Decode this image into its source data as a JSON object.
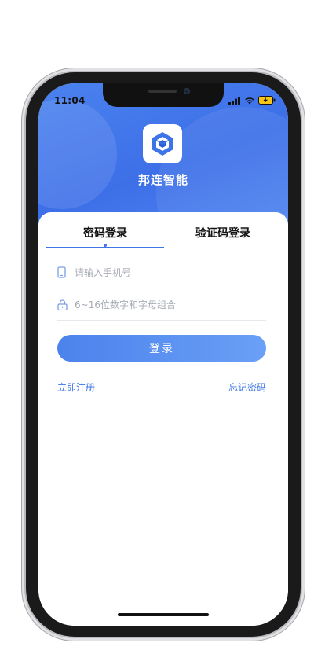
{
  "status_bar": {
    "time": "11:04"
  },
  "app": {
    "name": "邦连智能"
  },
  "tabs": [
    {
      "label": "密码登录",
      "active": true
    },
    {
      "label": "验证码登录",
      "active": false
    }
  ],
  "form": {
    "phone_placeholder": "请输入手机号",
    "password_placeholder": "6~16位数字和字母组合",
    "login_label": "登录"
  },
  "links": {
    "register": "立即注册",
    "forgot": "忘记密码"
  },
  "colors": {
    "accent": "#3d74e8",
    "header": "#4a82ee"
  },
  "icons": {
    "phone_field": "mobile-phone-icon",
    "password_field": "lock-icon"
  }
}
